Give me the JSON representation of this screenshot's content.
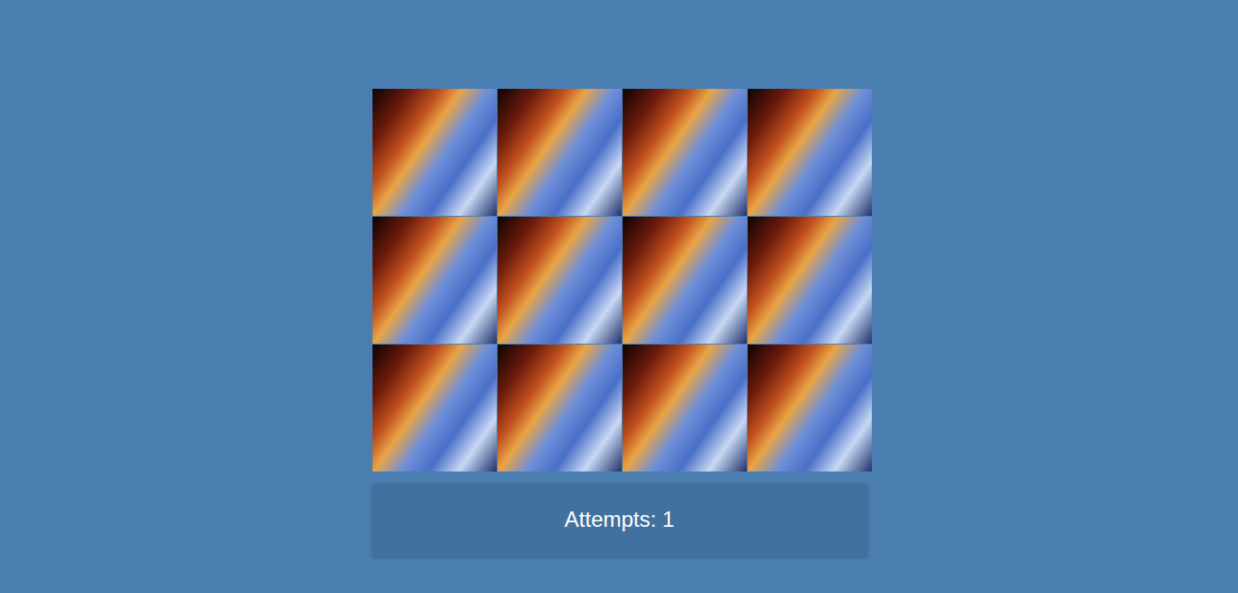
{
  "cards": [
    {
      "face_up": false
    },
    {
      "face_up": false
    },
    {
      "face_up": false
    },
    {
      "face_up": false
    },
    {
      "face_up": false
    },
    {
      "face_up": false
    },
    {
      "face_up": false
    },
    {
      "face_up": false
    },
    {
      "face_up": false
    },
    {
      "face_up": false
    },
    {
      "face_up": false
    },
    {
      "face_up": false
    }
  ],
  "status": {
    "label": "Attempts: 1"
  }
}
